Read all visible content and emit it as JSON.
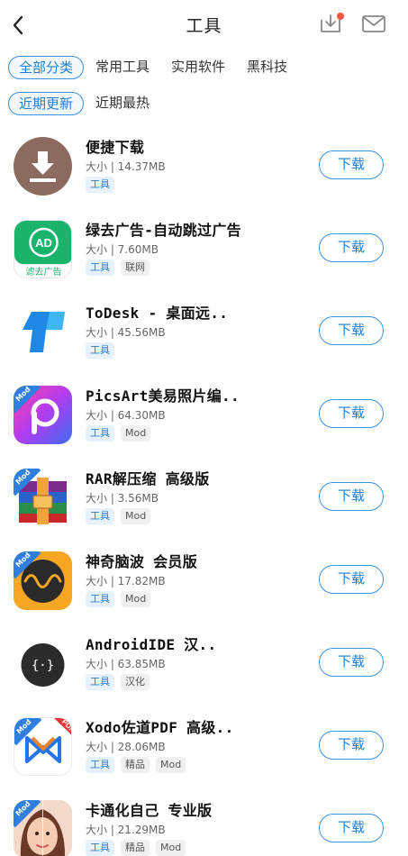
{
  "header": {
    "title": "工具",
    "back_icon": "chevron-left-icon",
    "download_icon": "download-tray-icon",
    "mail_icon": "envelope-icon",
    "notification_dot_color": "#f2543f"
  },
  "category_tabs": [
    {
      "label": "全部分类",
      "active": true
    },
    {
      "label": "常用工具",
      "active": false
    },
    {
      "label": "实用软件",
      "active": false
    },
    {
      "label": "黑科技",
      "active": false
    }
  ],
  "sort_tabs": [
    {
      "label": "近期更新",
      "active": true
    },
    {
      "label": "近期最热",
      "active": false
    }
  ],
  "accent_color": "#1f7fd6",
  "apps": [
    {
      "name": "便捷下载",
      "size": "大小 | 14.37MB",
      "tags": [
        "工具"
      ],
      "button": "下载"
    },
    {
      "name": "绿去广告-自动跳过广告",
      "size": "大小 | 7.60MB",
      "tags": [
        "工具",
        "联网"
      ],
      "button": "下载",
      "icon_text": "AD",
      "icon_caption": "滤去广告"
    },
    {
      "name": "ToDesk - 桌面远..",
      "size": "大小 | 45.56MB",
      "tags": [
        "工具"
      ],
      "button": "下载"
    },
    {
      "name": "PicsArt美易照片编..",
      "size": "大小 | 64.30MB",
      "tags": [
        "工具",
        "Mod"
      ],
      "button": "下载",
      "badge": "Mod"
    },
    {
      "name": "RAR解压缩 高级版",
      "size": "大小 | 3.56MB",
      "tags": [
        "工具",
        "Mod"
      ],
      "button": "下载",
      "badge": "Mod"
    },
    {
      "name": "神奇脑波 会员版",
      "size": "大小 | 17.82MB",
      "tags": [
        "工具",
        "Mod"
      ],
      "button": "下载",
      "badge": "Mod"
    },
    {
      "name": "AndroidIDE 汉..",
      "size": "大小 | 63.85MB",
      "tags": [
        "工具",
        "汉化"
      ],
      "button": "下载",
      "icon_text": "{·}"
    },
    {
      "name": "Xodo佐道PDF 高级..",
      "size": "大小 | 28.06MB",
      "tags": [
        "工具",
        "精品",
        "Mod"
      ],
      "button": "下载",
      "badge": "Mod",
      "icon_text": "PDF"
    },
    {
      "name": "卡通化自己 专业版",
      "size": "大小 | 21.29MB",
      "tags": [
        "工具",
        "精品",
        "Mod"
      ],
      "button": "下载",
      "badge": "Mod"
    }
  ]
}
